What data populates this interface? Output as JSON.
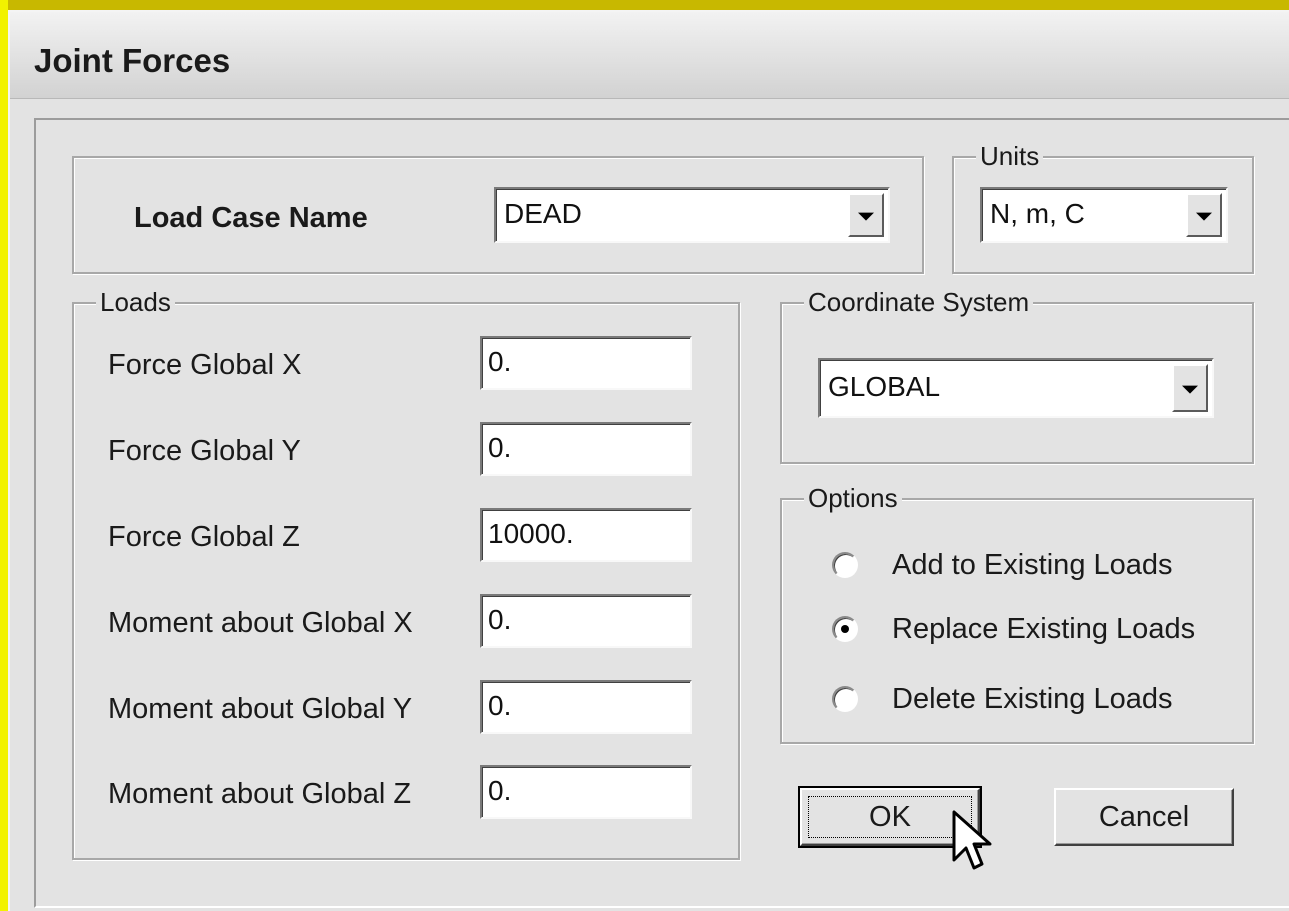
{
  "window": {
    "title": "Joint Forces"
  },
  "load_case": {
    "label": "Load Case Name",
    "value": "DEAD"
  },
  "units": {
    "group_label": "Units",
    "value": "N, m, C"
  },
  "loads": {
    "group_label": "Loads",
    "rows": [
      {
        "label": "Force Global X",
        "value": "0."
      },
      {
        "label": "Force Global Y",
        "value": "0."
      },
      {
        "label": "Force Global Z",
        "value": "10000."
      },
      {
        "label": "Moment about Global X",
        "value": "0."
      },
      {
        "label": "Moment about Global Y",
        "value": "0."
      },
      {
        "label": "Moment about Global Z",
        "value": "0."
      }
    ]
  },
  "coordinate_system": {
    "group_label": "Coordinate System",
    "value": "GLOBAL"
  },
  "options": {
    "group_label": "Options",
    "items": [
      {
        "label": "Add to Existing Loads",
        "checked": false
      },
      {
        "label": "Replace Existing Loads",
        "checked": true
      },
      {
        "label": "Delete Existing Loads",
        "checked": false
      }
    ]
  },
  "buttons": {
    "ok": "OK",
    "cancel": "Cancel"
  },
  "icons": {
    "dropdown": "chevron-down-icon",
    "cursor": "mouse-pointer-icon"
  }
}
